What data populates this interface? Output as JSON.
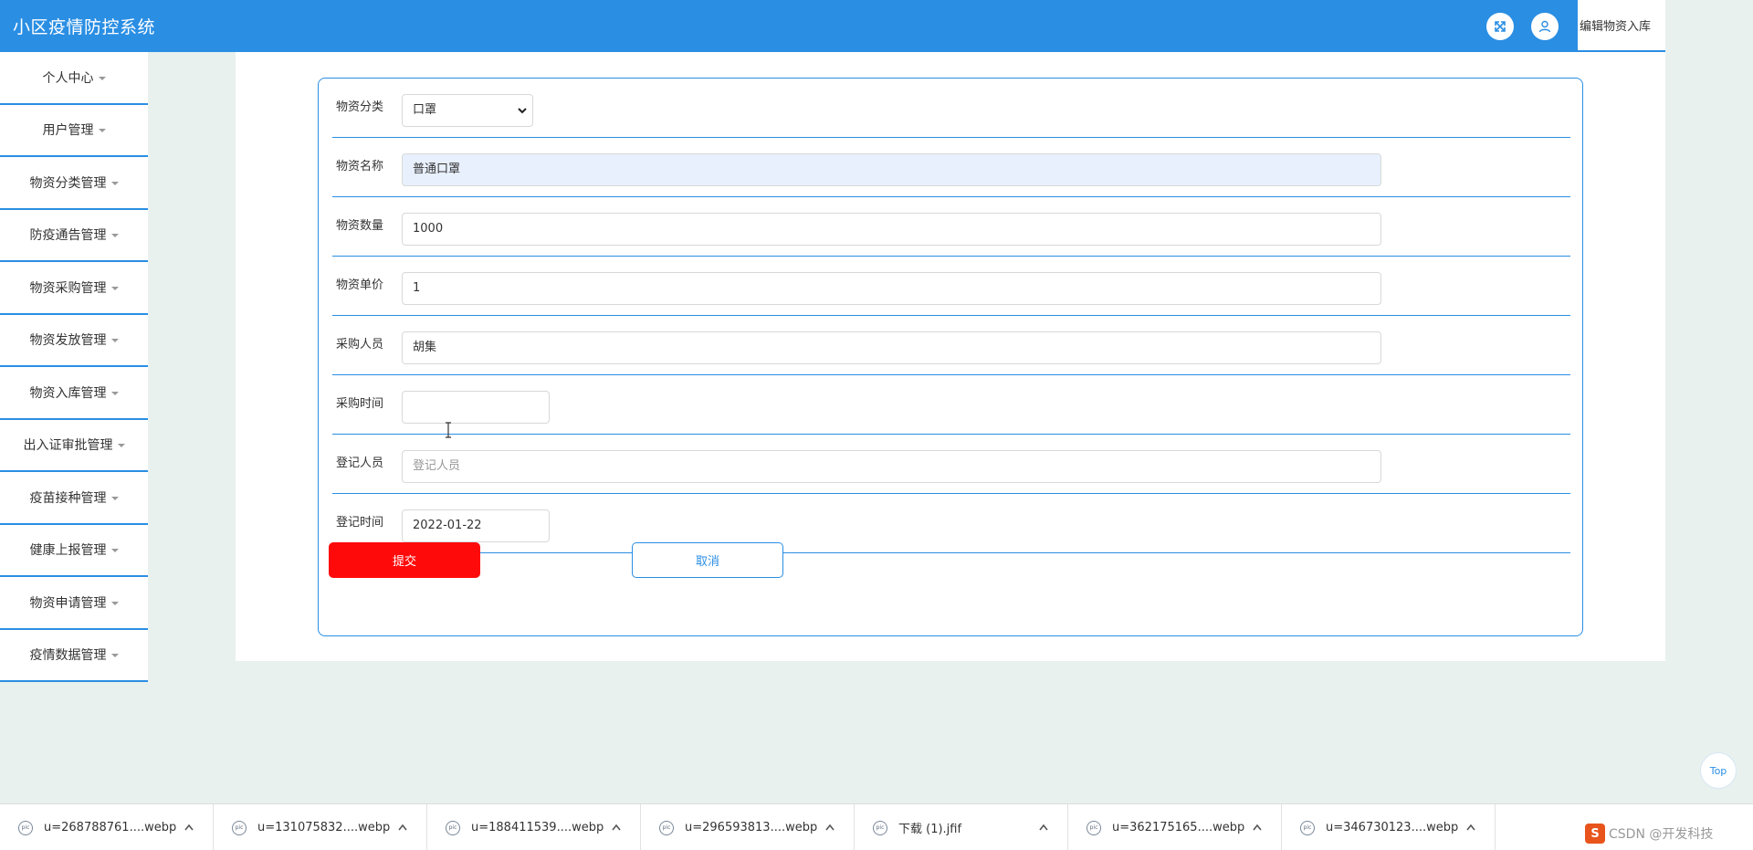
{
  "header": {
    "app_title": "小区疫情防控系统",
    "active_tab": "编辑物资入库",
    "fullscreen_icon": "expand-icon",
    "user_icon": "user-icon"
  },
  "sidebar": {
    "items": [
      {
        "label": "个人中心"
      },
      {
        "label": "用户管理"
      },
      {
        "label": "物资分类管理"
      },
      {
        "label": "防疫通告管理"
      },
      {
        "label": "物资采购管理"
      },
      {
        "label": "物资发放管理"
      },
      {
        "label": "物资入库管理"
      },
      {
        "label": "出入证审批管理"
      },
      {
        "label": "疫苗接种管理"
      },
      {
        "label": "健康上报管理"
      },
      {
        "label": "物资申请管理"
      },
      {
        "label": "疫情数据管理"
      }
    ]
  },
  "form": {
    "category": {
      "label": "物资分类",
      "value": "口罩"
    },
    "name": {
      "label": "物资名称",
      "value": "普通口罩"
    },
    "quantity": {
      "label": "物资数量",
      "value": "1000"
    },
    "unit_price": {
      "label": "物资单价",
      "value": "1"
    },
    "purchaser": {
      "label": "采购人员",
      "value": "胡集"
    },
    "purchase_time": {
      "label": "采购时间",
      "value": ""
    },
    "registrar": {
      "label": "登记人员",
      "value": "",
      "placeholder": "登记人员"
    },
    "register_time": {
      "label": "登记时间",
      "value": "2022-01-22"
    },
    "submit_label": "提交",
    "cancel_label": "取消"
  },
  "top_button": "Top",
  "downloads": [
    {
      "name": "u=268788761....webp"
    },
    {
      "name": "u=131075832....webp"
    },
    {
      "name": "u=188411539....webp"
    },
    {
      "name": "u=296593813....webp"
    },
    {
      "name": "下载 (1).jfif"
    },
    {
      "name": "u=362175165....webp"
    },
    {
      "name": "u=346730123....webp"
    }
  ],
  "tray": {
    "logo": "S",
    "text": "CSDN @开发科技"
  },
  "colors": {
    "primary": "#2a8ee3",
    "submit": "#ff0a0a",
    "background": "#e8f1ee"
  }
}
